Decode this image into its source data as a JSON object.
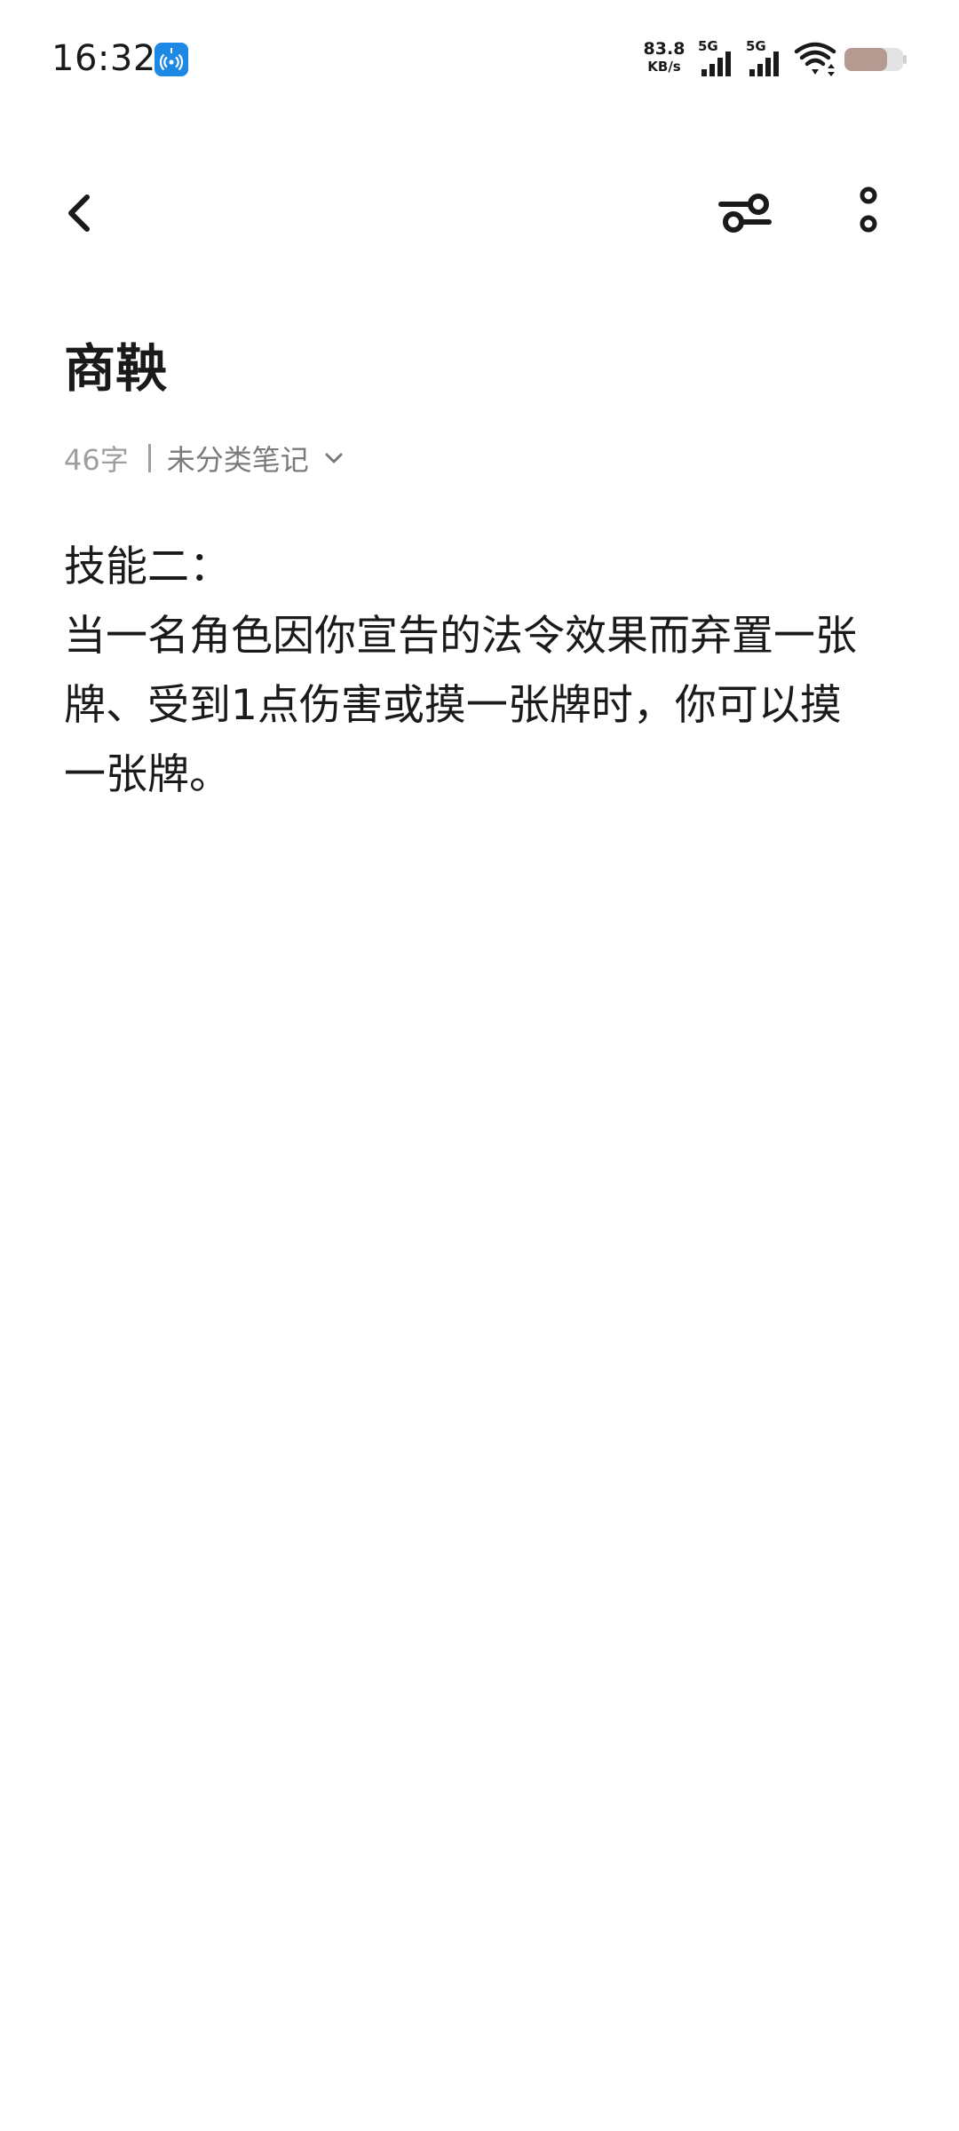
{
  "status_bar": {
    "time": "16:32",
    "net_speed_value": "83.8",
    "net_speed_unit": "KB/s",
    "sim1_tag": "5G",
    "sim2_tag": "5G",
    "icons": [
      "hotspot-icon",
      "signal-icon",
      "signal-icon",
      "wifi-icon",
      "battery-icon"
    ],
    "hotspot_color": "#1e88e5"
  },
  "toolbar": {
    "back_icon": "chevron-left-icon",
    "filter_icon": "sliders-icon",
    "more_icon": "more-vertical-icon"
  },
  "note": {
    "title": "商鞅",
    "word_count": "46字",
    "category": "未分类笔记",
    "body_lines": [
      "技能二：",
      "当一名角色因你宣告的法令效果而弃置一张",
      "牌、受到1点伤害或摸一张牌时，你可以摸",
      "一张牌。"
    ]
  }
}
